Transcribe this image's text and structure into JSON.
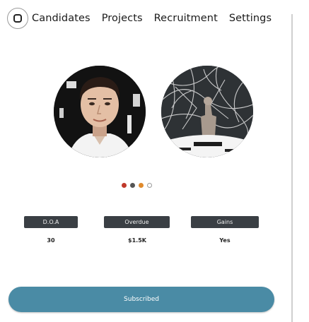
{
  "nav": {
    "logo_icon": "rounded-square-icon",
    "items": [
      "Candidates",
      "Projects",
      "Recruitment",
      "Settings"
    ]
  },
  "profiles": [
    {
      "name": "person-portrait-photo"
    },
    {
      "name": "abstract-art-photo"
    }
  ],
  "carousel": {
    "dot_colors": [
      "#c0392b",
      "#555555",
      "#e08a2b",
      "#ffffff"
    ]
  },
  "stats": [
    {
      "label": "D.O.A",
      "value": "30"
    },
    {
      "label": "Overdue",
      "value": "$1.5K"
    },
    {
      "label": "Gains",
      "value": "Yes"
    }
  ],
  "primary_button": {
    "label": "Subscribed"
  },
  "colors": {
    "primary": "#4a8ba5",
    "label_bg": "#3a3f44"
  }
}
